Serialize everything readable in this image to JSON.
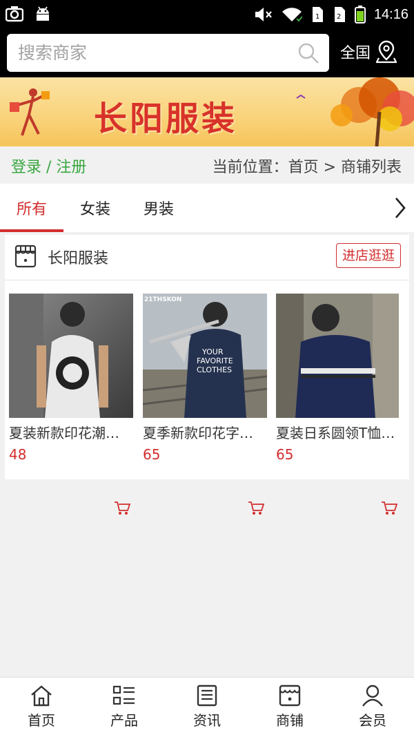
{
  "status_bar": {
    "time": "14:16",
    "left_icons": [
      "camera-icon",
      "android-icon"
    ],
    "right_icons": [
      "mute-icon",
      "wifi-icon",
      "sim1-icon",
      "sim2-icon",
      "battery-icon"
    ]
  },
  "search": {
    "placeholder": "搜索商家",
    "region_label": "全国"
  },
  "banner": {
    "title": "长阳服装"
  },
  "crumbs": {
    "login": "登录 / 注册",
    "location": "当前位置：首页 > 商铺列表"
  },
  "tabs": [
    {
      "label": "所有",
      "active": true
    },
    {
      "label": "女装",
      "active": false
    },
    {
      "label": "男装",
      "active": false
    }
  ],
  "store": {
    "name": "长阳服装",
    "visit_label": "进店逛逛",
    "products": [
      {
        "name": "夏装新款印花潮…",
        "price": "48"
      },
      {
        "name": "夏季新款印花字…",
        "price": "65"
      },
      {
        "name": "夏装日系圆领T恤…",
        "price": "65"
      }
    ],
    "product_shirt_text": "YOUR FAVORITE CLOTHES",
    "product_brand_tag": "21THSKON"
  },
  "bottom_nav": [
    {
      "label": "首页",
      "icon": "home-icon"
    },
    {
      "label": "产品",
      "icon": "list-icon"
    },
    {
      "label": "资讯",
      "icon": "news-icon"
    },
    {
      "label": "商铺",
      "icon": "store-icon"
    },
    {
      "label": "会员",
      "icon": "user-icon"
    }
  ],
  "colors": {
    "accent": "#d32d2d",
    "login_green": "#3aa641",
    "header_bg": "#000000"
  }
}
